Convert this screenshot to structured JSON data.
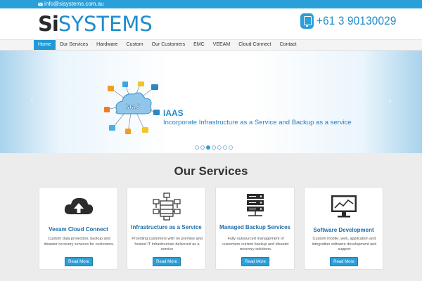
{
  "topbar": {
    "email": "info@sisystems.com.au"
  },
  "header": {
    "logo_si": "Si",
    "logo_rest": "SYSTEMS",
    "phone": "+61 3 90130029"
  },
  "nav": {
    "items": [
      "Home",
      "Our Services",
      "Hardware",
      "Custom",
      "Our Customers",
      "EMC",
      "VEEAM",
      "Cloud Connect",
      "Contact"
    ],
    "active_index": 0
  },
  "hero": {
    "cloud_label": "IaaS",
    "title": "IAAS",
    "subtitle": "Incorporate Infrastructure as a Service and Backup as a service",
    "prev": "‹",
    "next": "›",
    "slide_count": 7,
    "active_slide": 2
  },
  "services": {
    "title": "Our Services",
    "cards": [
      {
        "icon": "cloud-upload-icon",
        "title": "Veeam Cloud Connect",
        "desc": "Custom data protection, backup and disaster recovery services for customers.",
        "button": "Read More"
      },
      {
        "icon": "infrastructure-network-icon",
        "title": "Infrastructure as a Service",
        "desc": "Providing customers with on premise and hosted IT infrastructure delivered as a service",
        "button": "Read More"
      },
      {
        "icon": "server-rack-icon",
        "title": "Managed Backup Services",
        "desc": "Fully outsourced management of customers current backup and disaster recovery solutions.",
        "button": "Read More"
      },
      {
        "icon": "monitor-chart-icon",
        "title": "Software Development",
        "desc": "Custom mobile, web, application and integration software development and support",
        "button": "Read More"
      }
    ]
  },
  "colors": {
    "accent": "#2a9fd8",
    "brand_dark": "#2b2b2b",
    "title_blue": "#1f6fa8"
  }
}
